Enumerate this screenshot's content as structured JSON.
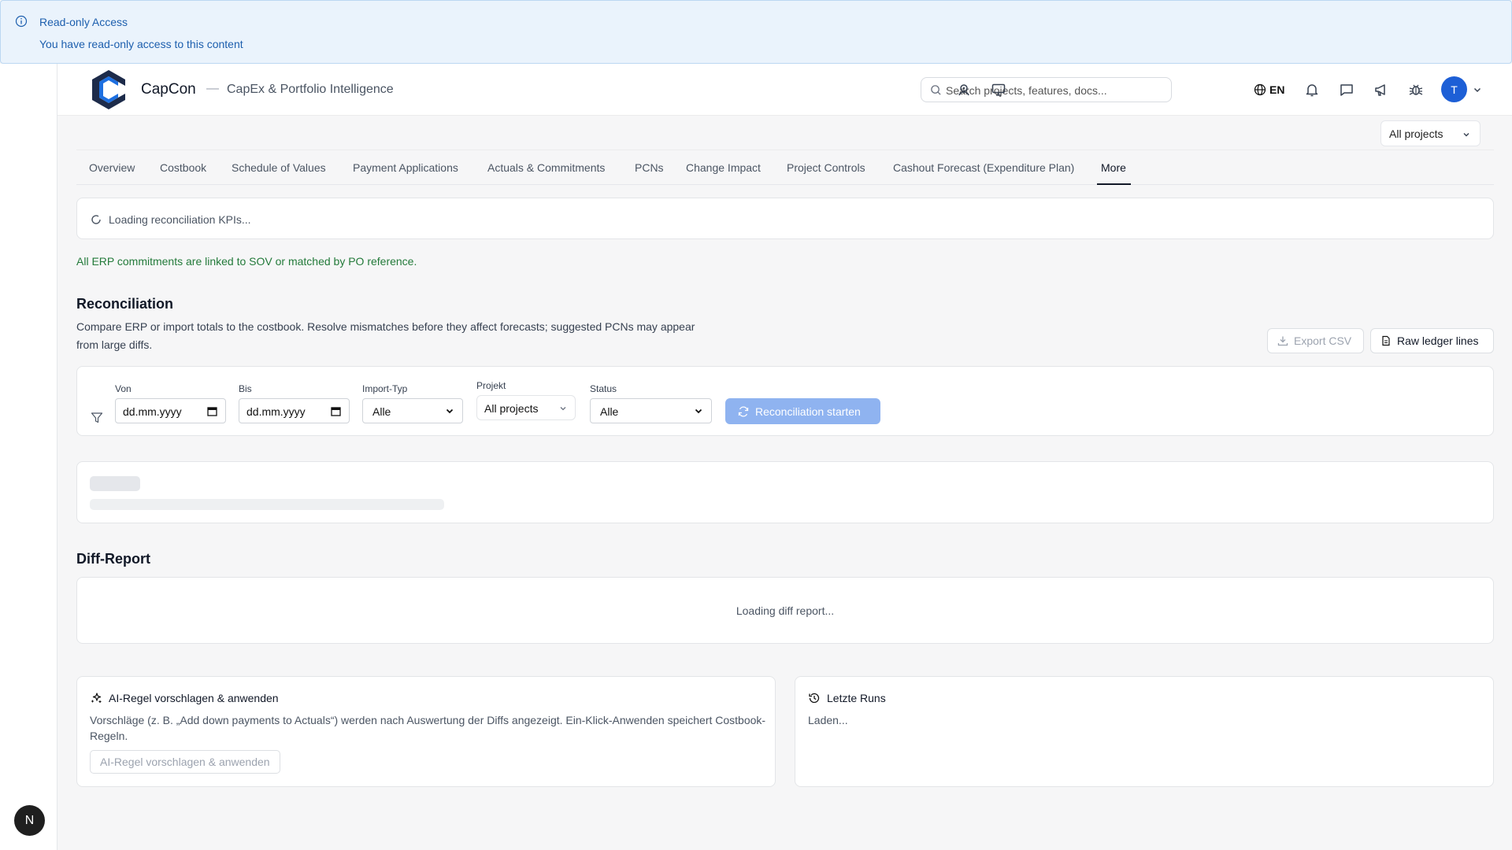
{
  "banner": {
    "title": "Read-only Access",
    "message": "You have read-only access to this content"
  },
  "header": {
    "brand": "CapCon",
    "separator": "—",
    "tagline": "CapEx & Portfolio Intelligence",
    "search_placeholder": "Search projects, features, docs...",
    "language": "EN",
    "avatar_initial": "T",
    "icons": [
      "user-icon",
      "monitor-icon",
      "globe-icon",
      "bell-icon",
      "chat-icon",
      "megaphone-icon",
      "bug-icon"
    ]
  },
  "project_select": {
    "value": "All projects"
  },
  "tabs": [
    {
      "label": "Overview"
    },
    {
      "label": "Costbook"
    },
    {
      "label": "Schedule of Values"
    },
    {
      "label": "Payment Applications"
    },
    {
      "label": "Actuals & Commitments"
    },
    {
      "label": "PCNs"
    },
    {
      "label": "Change Impact"
    },
    {
      "label": "Project Controls"
    },
    {
      "label": "Cashout Forecast (Expenditure Plan)"
    },
    {
      "label": "More",
      "active": true
    }
  ],
  "kpi": {
    "loading_text": "Loading reconciliation KPIs..."
  },
  "status_message": "All ERP commitments are linked to SOV or matched by PO reference.",
  "reconciliation": {
    "title": "Reconciliation",
    "description": "Compare ERP or import totals to the costbook. Resolve mismatches before they affect forecasts; suggested PCNs may appear from large diffs.",
    "export_label": "Export CSV",
    "raw_label": "Raw ledger lines"
  },
  "filters": {
    "from_label": "Von",
    "from_value": "dd.mm.yyyy",
    "to_label": "Bis",
    "to_value": "dd.mm.yyyy",
    "import_type_label": "Import-Typ",
    "import_type_value": "Alle",
    "project_label": "Projekt",
    "project_value": "All projects",
    "status_label": "Status",
    "status_value": "Alle",
    "run_label": "Reconciliation starten"
  },
  "diff_report": {
    "title": "Diff-Report",
    "loading_text": "Loading diff report..."
  },
  "ai_rule": {
    "title": "AI-Regel vorschlagen & anwenden",
    "text": "Vorschläge (z. B. „Add down payments to Actuals“) werden nach Auswertung der Diffs angezeigt. Ein-Klick-Anwenden speichert Costbook-Regeln.",
    "button_label": "AI-Regel vorschlagen & anwenden"
  },
  "recent_runs": {
    "title": "Letzte Runs",
    "loading_text": "Laden..."
  },
  "dev_badge": "N",
  "colors": {
    "banner_bg": "#eaf3fc",
    "banner_text": "#1d5fae",
    "accent": "#1d5fd6",
    "run_button": "#8fb3f0",
    "success_text": "#237a3a"
  }
}
